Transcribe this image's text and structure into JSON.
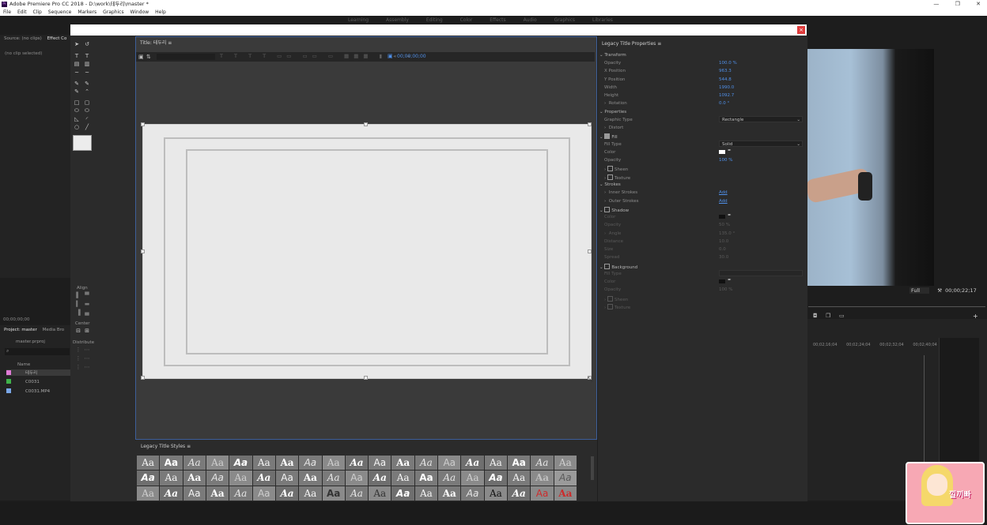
{
  "app": {
    "title": "Adobe Premiere Pro CC 2018 - D:\\work\\테두리\\master *",
    "logo": "Pr",
    "window_controls": [
      "—",
      "❐",
      "✕"
    ]
  },
  "menu": [
    "File",
    "Edit",
    "Clip",
    "Sequence",
    "Markers",
    "Graphics",
    "Window",
    "Help"
  ],
  "workspaces": [
    "Learning",
    "Assembly",
    "Editing",
    "Color",
    "Effects",
    "Audio",
    "Graphics",
    "Libraries"
  ],
  "source_panel": {
    "tabs": [
      "Source: (no clips)",
      "Effect Co"
    ],
    "empty": "(no clip selected)",
    "timecode": "00;00;00;00"
  },
  "project_panel": {
    "tabs": [
      "Project: master",
      "Media Bro"
    ],
    "file": "master.prproj",
    "name_header": "Name",
    "items": [
      {
        "label": "테두리",
        "color": "#e07bd6"
      },
      {
        "label": "C0031",
        "color": "#3fb24a"
      },
      {
        "label": "C0031.MP4",
        "color": "#7aa7e8"
      }
    ]
  },
  "title_dialog": {
    "close": "×",
    "title_tab": "Title: 테두리",
    "toolbar_timecode": "00;00;00;00",
    "labels": {
      "align": "Align",
      "center": "Center",
      "distribute": "Distribute"
    }
  },
  "properties": {
    "header": "Legacy Title Properties",
    "transform": "Transform",
    "opacity_label": "Opacity",
    "opacity_val": "100.0 %",
    "xpos_label": "X Position",
    "xpos_val": "963.3",
    "ypos_label": "Y Position",
    "ypos_val": "544.8",
    "width_label": "Width",
    "width_val": "1990.0",
    "height_label": "Height",
    "height_val": "1092.7",
    "rotation_label": "Rotation",
    "rotation_val": "0.0 °",
    "properties_h": "Properties",
    "graphic_type_label": "Graphic Type",
    "graphic_type_val": "Rectangle",
    "distort": "Distort",
    "fill": "Fill",
    "fill_type_label": "Fill Type",
    "fill_type_val": "Solid",
    "color_label": "Color",
    "fill_opacity_label": "Opacity",
    "fill_opacity_val": "100 %",
    "sheen": "Sheen",
    "texture": "Texture",
    "strokes": "Strokes",
    "inner_strokes": "Inner Strokes",
    "inner_add": "Add",
    "outer_strokes": "Outer Strokes",
    "outer_add": "Add",
    "shadow": "Shadow",
    "sh_color": "Color",
    "sh_opacity": "Opacity",
    "sh_opacity_val": "50 %",
    "sh_angle": "Angle",
    "sh_angle_val": "135.0 °",
    "sh_distance": "Distance",
    "sh_distance_val": "10.0",
    "sh_size": "Size",
    "sh_size_val": "0.0",
    "sh_spread": "Spread",
    "sh_spread_val": "30.0",
    "background": "Background",
    "bg_fill_type": "Fill Type",
    "bg_color": "Color",
    "bg_opacity": "Opacity",
    "bg_opacity_val": "100 %",
    "bg_sheen": "Sheen",
    "bg_texture": "Texture"
  },
  "styles_panel": {
    "header": "Legacy Title Styles",
    "sample": "Aa"
  },
  "program_monitor": {
    "zoom": "Full",
    "timecode": "00;00;22;17"
  },
  "timeline": {
    "times": [
      "00;02;16;04",
      "00;02;24;04",
      "00;02;32;04",
      "00;02;40;04"
    ]
  },
  "avatar": {
    "text": "낄끼빠"
  }
}
